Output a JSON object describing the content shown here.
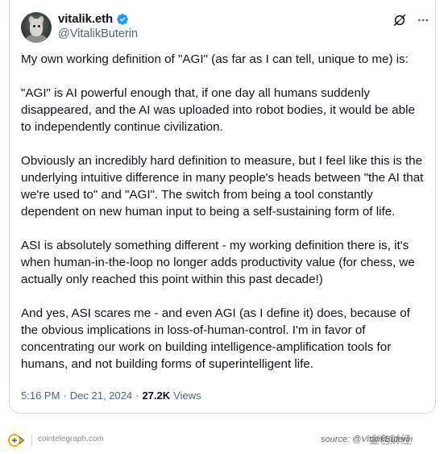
{
  "tweet": {
    "author": {
      "display_name": "vitalik.eth",
      "handle": "@VitalikButerin",
      "verified": true
    },
    "header_icons": [
      "grok-icon",
      "more-options-icon"
    ],
    "paragraphs": [
      "My own working definition of \"AGI\" (as far as I can tell, unique to me) is:",
      "\"AGI\" is AI powerful enough that, if one day all humans suddenly disappeared, and the AI was uploaded into robot bodies, it would be able to independently continue civilization.",
      "Obviously an incredibly hard definition to measure, but I feel like this is the underlying intuitive difference in many people's heads between \"the AI that we're used to\" and \"AGI\". The switch from being a tool constantly dependent on new human input to being a self-sustaining form of life.",
      "ASI is absolutely something different - my working definition there is, it's when human-in-the-loop no longer adds productivity value (for chess, we actually only reached this point within this past decade!)",
      "And yes, ASI scares me - and even AGI (as I define it) does, because of the obvious implications in loss-of-human-control. I'm in favor of concentrating our work on building intelligence-amplification tools for humans, and not building forms of superintelligent life."
    ],
    "meta": {
      "time": "5:16 PM",
      "separator": "·",
      "date": "Dec 21, 2024",
      "views_count": "27.2K",
      "views_label": "Views"
    }
  },
  "footer": {
    "domain": "cointelegraph.com",
    "source_text": "source: @VitalikButerin",
    "watermark": "金色财经"
  },
  "colors": {
    "verified_blue": "#1d9bf0",
    "secondary_text": "#536471",
    "primary_text": "#0f1419",
    "card_border": "#cfd9de"
  }
}
